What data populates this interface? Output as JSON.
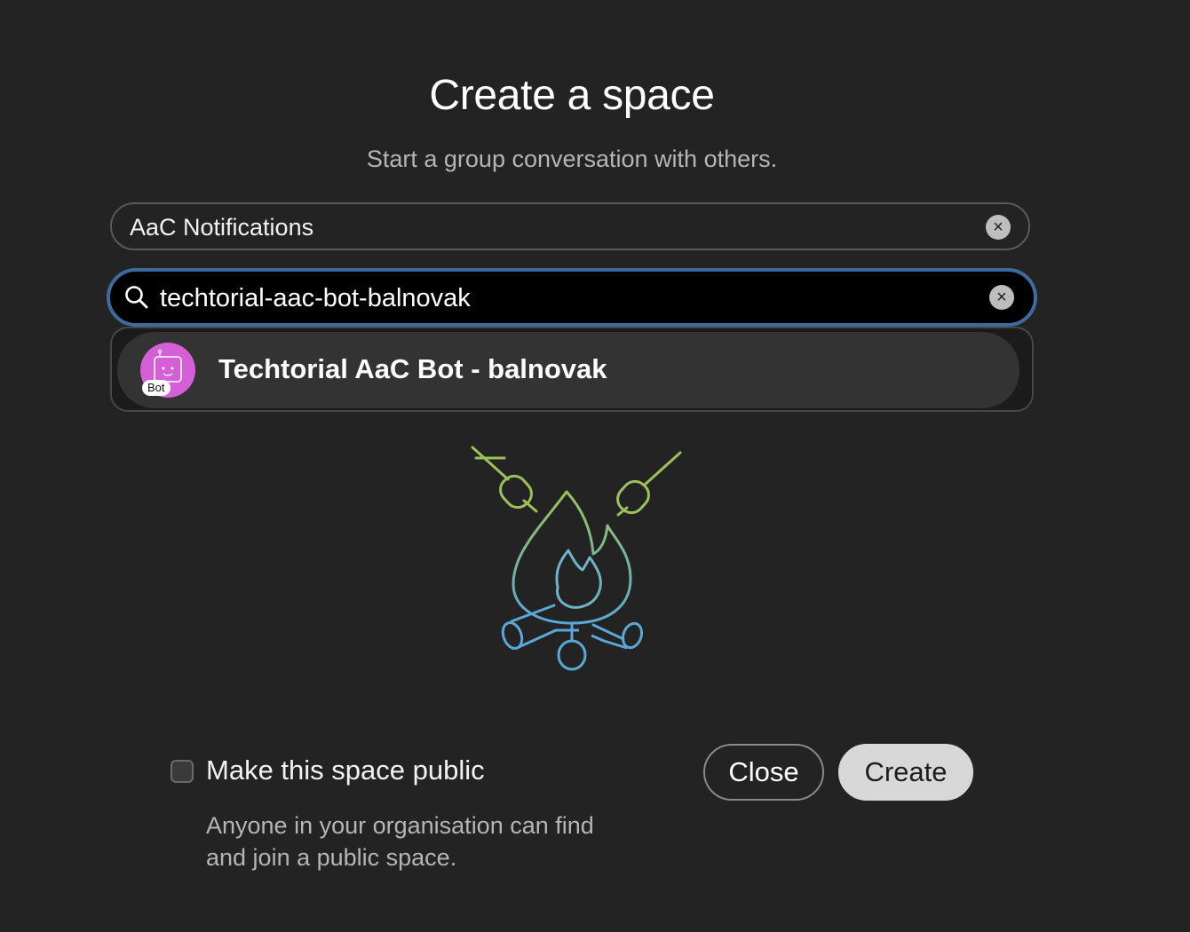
{
  "dialog": {
    "title": "Create a space",
    "subtitle": "Start a group conversation with others."
  },
  "space_name": {
    "value": "AaC Notifications",
    "clear_icon": "close-icon"
  },
  "people_search": {
    "value": "techtorial-aac-bot-balnovak",
    "search_icon": "search-icon",
    "clear_icon": "close-icon",
    "focus_color": "#3d6b9f"
  },
  "results": [
    {
      "name": "Techtorial AaC Bot - balnovak",
      "badge": "Bot",
      "avatar_color": "#d45fd6"
    }
  ],
  "illustration": {
    "icon": "campfire-marshmallows-illustration",
    "colors": [
      "#9bc25a",
      "#5aa8d8"
    ]
  },
  "public_option": {
    "label": "Make this space public",
    "checked": false,
    "help_text": "Anyone in your organisation can find and join a public space."
  },
  "actions": {
    "close_label": "Close",
    "create_label": "Create"
  }
}
